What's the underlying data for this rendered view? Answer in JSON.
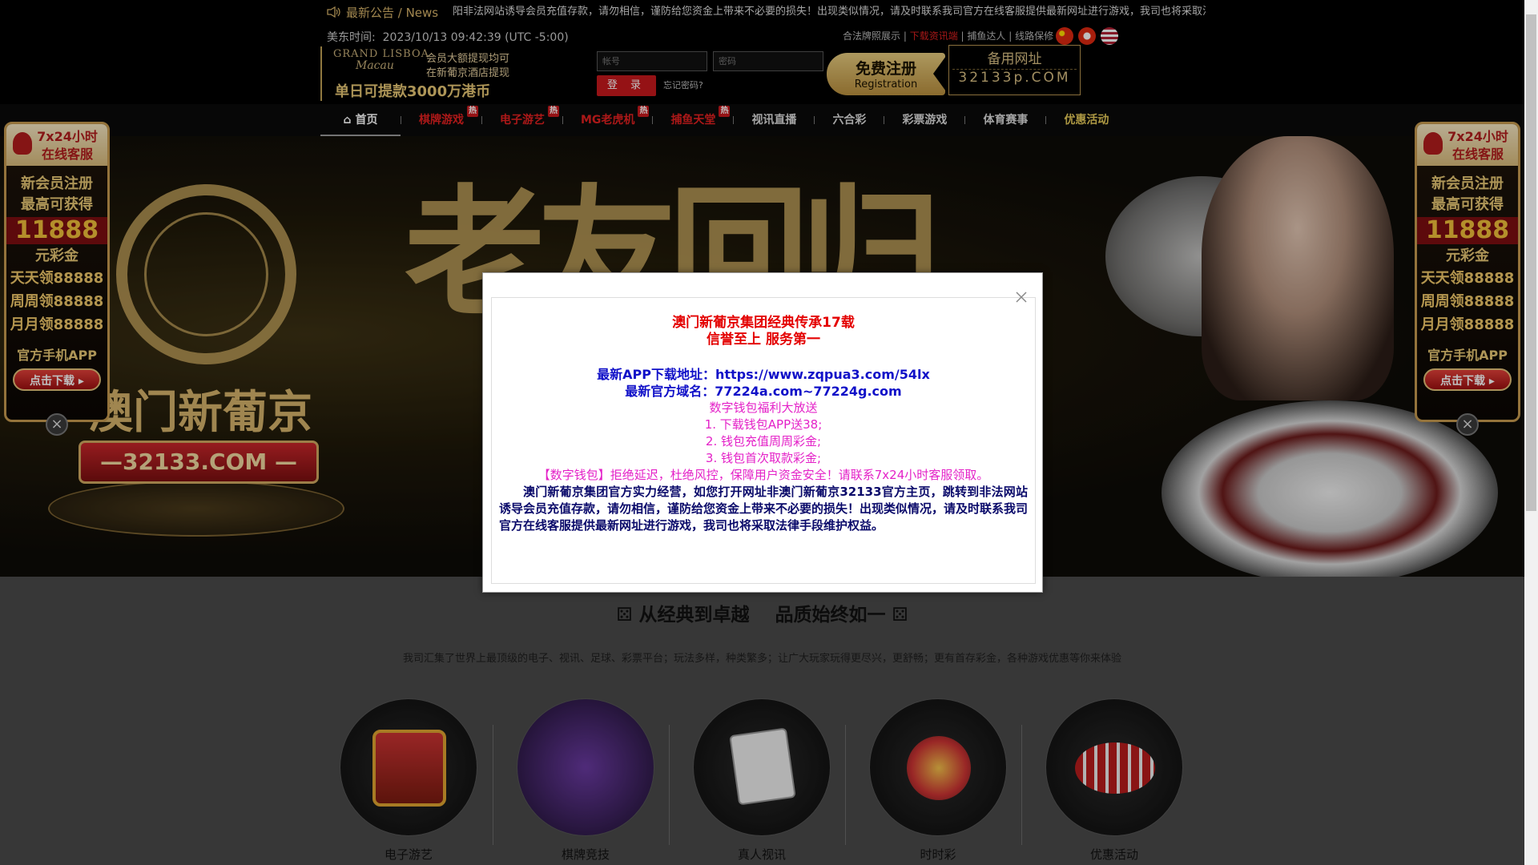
{
  "notice": {
    "label": "最新公告 / News",
    "marquee": "阳非法网站诱导会员充值存款，请勿相信，谨防给您资金上带来不必要的损失！出现类似情况，请及时联系我司官方在线客服提供最新网址进行游戏，我司也将采取法律手段维护"
  },
  "header": {
    "time_label": "美东时间:",
    "time_value": "2023/10/13 09:42:39 (UTC -5:00)",
    "brand": {
      "grand_lisboa": "GRAND LISBOA",
      "macau": "Macau",
      "line1": "会员大额提现均可",
      "line2": "在新葡京酒店提现",
      "line3": "单日可提款3000万港币"
    },
    "login": {
      "account_placeholder": "帐号",
      "password_placeholder": "密码",
      "login_button": "登 录",
      "forgot": "忘记密码?"
    },
    "register": {
      "main": "免费注册",
      "sub": "Registration"
    },
    "backup": {
      "title": "备用网址",
      "url": "32133p.COM"
    },
    "links": [
      "合法牌照展示",
      "下载资讯端",
      "捕鱼达人",
      "线路保修"
    ]
  },
  "nav": {
    "items": [
      {
        "label": "首页",
        "hot": ""
      },
      {
        "label": "棋牌游戏",
        "hot": "热"
      },
      {
        "label": "电子游艺",
        "hot": "热"
      },
      {
        "label": "MG老虎机",
        "hot": "热"
      },
      {
        "label": "捕鱼天堂",
        "hot": "热"
      },
      {
        "label": "视讯直播",
        "hot": ""
      },
      {
        "label": "六合彩",
        "hot": ""
      },
      {
        "label": "彩票游戏",
        "hot": ""
      },
      {
        "label": "体育赛事",
        "hot": ""
      },
      {
        "label": "优惠活动",
        "hot": ""
      }
    ]
  },
  "banner": {
    "title": "老友回归",
    "brand_cn": "澳门新葡京",
    "domain": "—32133.COM —"
  },
  "side": {
    "header1": "7x24小时",
    "header2": "在线客服",
    "reg1": "新会员注册",
    "reg2": "最高可获得",
    "amount": "11888",
    "unit": "元彩金",
    "daily": "天天领88888",
    "weekly": "周周领88888",
    "monthly": "月月领88888",
    "app": "官方手机APP",
    "download": "点击下载 ▸",
    "close": "×"
  },
  "modal": {
    "line1": "澳门新葡京集团经典传承17载",
    "line2": "信誉至上 服务第一",
    "app_line": "最新APP下载地址：https://www.zqpua3.com/54lx",
    "domain_line": "最新官方域名：77224a.com~77224g.com",
    "wallet_title": "数字钱包福利大放送",
    "wallet_1": "1. 下载钱包APP送38;",
    "wallet_2": "2. 钱包充值周周彩金;",
    "wallet_3": "3. 钱包首次取款彩金;",
    "wallet_note": "【数字钱包】拒绝延迟，杜绝风控，保障用户资金安全！请联系7x24小时客服领取。",
    "paragraph": "澳门新葡京集团官方实力经营，如您打开网址非澳门新葡京32133官方主页，跳转到非法网站诱导会员充值存款，请勿相信，谨防给您资金上带来不必要的损失！出现类似情况，请及时联系我司官方在线客服提供最新网址进行游戏，我司也将采取法律手段维护权益。"
  },
  "slogan": "从经典到卓越    品质始终如一",
  "description": "我司汇集了世界上最顶级的电子、视讯、足球、彩票平台；玩法多样，种类繁多；让广大玩家玩得更尽兴，更舒畅；更有首存彩金，各种游戏优惠等你来体验",
  "categories": [
    "电子游艺",
    "棋牌竞技",
    "真人视讯",
    "时时彩",
    "优惠活动"
  ],
  "colors": {
    "accent_gold": "#c9a55a",
    "hot_red": "#c7181c",
    "modal_red": "#e40000",
    "modal_blue": "#1010c8",
    "modal_pink": "#e422c8"
  }
}
